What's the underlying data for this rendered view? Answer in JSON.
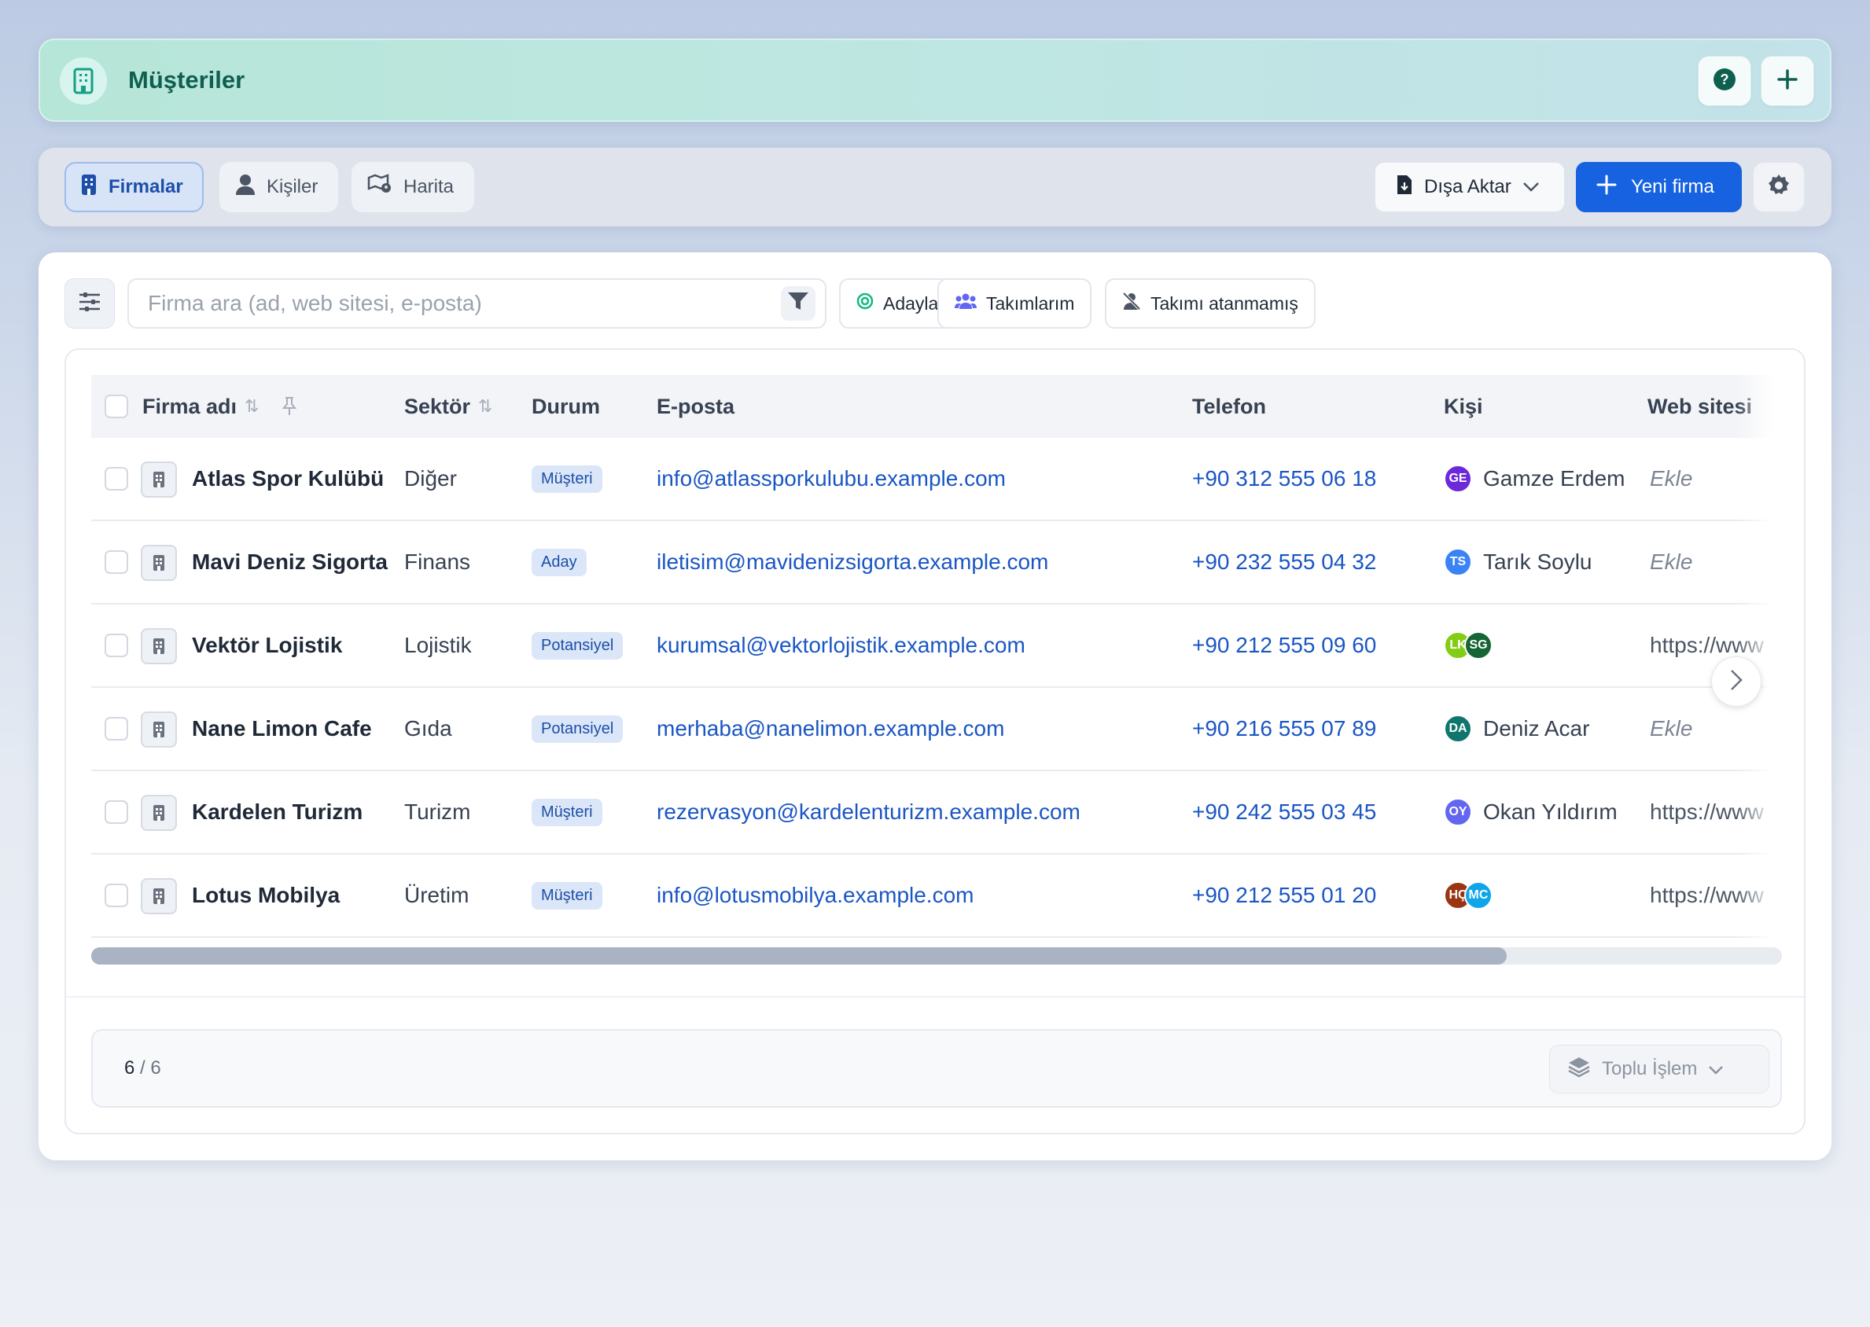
{
  "header": {
    "title": "Müşteriler",
    "help_icon": "question-circle-icon",
    "add_icon": "plus-icon"
  },
  "tabs": [
    {
      "label": "Firmalar",
      "icon": "building-icon",
      "active": true
    },
    {
      "label": "Kişiler",
      "icon": "person-icon",
      "active": false
    },
    {
      "label": "Harita",
      "icon": "map-icon",
      "active": false
    }
  ],
  "toolbar": {
    "export_label": "Dışa Aktar",
    "new_label": "Yeni firma"
  },
  "search": {
    "placeholder": "Firma ara (ad, web sitesi, e-posta)"
  },
  "chips": [
    {
      "label": "Adaylar",
      "icon": "target-icon"
    },
    {
      "label": "Takımlarım",
      "icon": "users-icon"
    },
    {
      "label": "Takımı atanmamış",
      "icon": "user-off-icon"
    }
  ],
  "columns": [
    "Firma adı",
    "Sektör",
    "Durum",
    "E-posta",
    "Telefon",
    "Kişi",
    "Web sitesi"
  ],
  "rows": [
    {
      "name": "Atlas Spor Kulübü",
      "sector": "Diğer",
      "status": "Müşteri",
      "email": "info@atlassporkulubu.example.com",
      "phone": "+90 312 555 06 18",
      "contacts": [
        {
          "initials": "GE",
          "color": "#6d28d9"
        }
      ],
      "contact_name": "Gamze Erdem",
      "website": "Ekle"
    },
    {
      "name": "Mavi Deniz Sigorta",
      "sector": "Finans",
      "status": "Aday",
      "email": "iletisim@mavidenizsigorta.example.com",
      "phone": "+90 232 555 04 32",
      "contacts": [
        {
          "initials": "TS",
          "color": "#3b82f6"
        }
      ],
      "contact_name": "Tarık Soylu",
      "website": "Ekle"
    },
    {
      "name": "Vektör Lojistik",
      "sector": "Lojistik",
      "status": "Potansiyel",
      "email": "kurumsal@vektorlojistik.example.com",
      "phone": "+90 212 555 09 60",
      "contacts": [
        {
          "initials": "LK",
          "color": "#84cc16"
        },
        {
          "initials": "SG",
          "color": "#166534"
        }
      ],
      "contact_name": "",
      "website": "https://www"
    },
    {
      "name": "Nane Limon Cafe",
      "sector": "Gıda",
      "status": "Potansiyel",
      "email": "merhaba@nanelimon.example.com",
      "phone": "+90 216 555 07 89",
      "contacts": [
        {
          "initials": "DA",
          "color": "#0f766e"
        }
      ],
      "contact_name": "Deniz Acar",
      "website": "Ekle"
    },
    {
      "name": "Kardelen Turizm",
      "sector": "Turizm",
      "status": "Müşteri",
      "email": "rezervasyon@kardelenturizm.example.com",
      "phone": "+90 242 555 03 45",
      "contacts": [
        {
          "initials": "OY",
          "color": "#6366f1"
        }
      ],
      "contact_name": "Okan Yıldırım",
      "website": "https://www"
    },
    {
      "name": "Lotus Mobilya",
      "sector": "Üretim",
      "status": "Müşteri",
      "email": "info@lotusmobilya.example.com",
      "phone": "+90 212 555 01 20",
      "contacts": [
        {
          "initials": "HÇ",
          "color": "#9a3412"
        },
        {
          "initials": "MC",
          "color": "#0ea5e9"
        }
      ],
      "contact_name": "",
      "website": "https://www"
    }
  ],
  "footer": {
    "shown": "6",
    "separator": "/",
    "total": "6",
    "bulk_label": "Toplu İşlem"
  },
  "colors": {
    "accent": "#1662e0",
    "header_title": "#0f5f50",
    "link": "#1a56c4"
  }
}
